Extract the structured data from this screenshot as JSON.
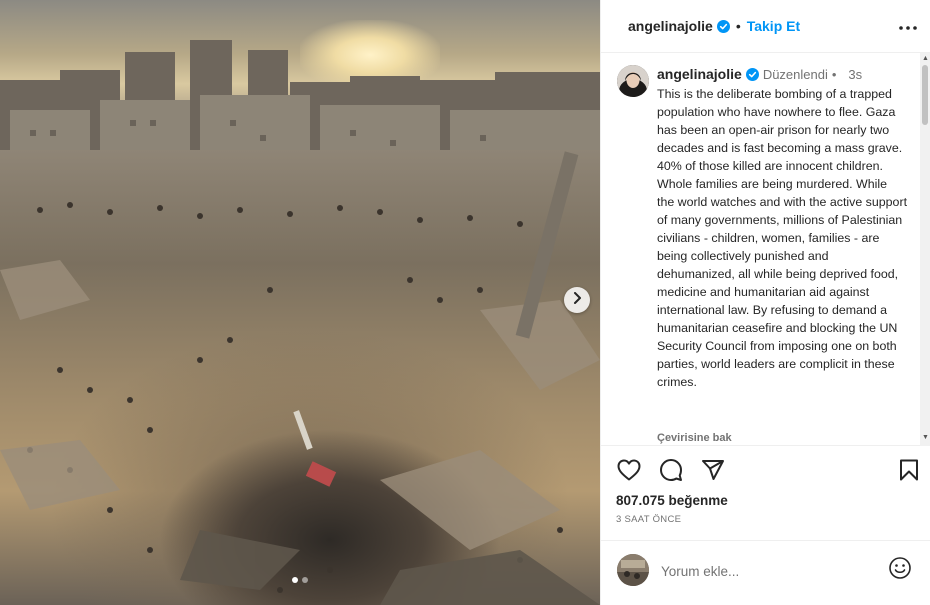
{
  "post": {
    "username": "angelinajolie",
    "follow_label": "Takip Et",
    "separator": "•",
    "edited_label": "Düzenlendi",
    "caption_time": "3s",
    "caption": "This is the deliberate bombing of a trapped population who have nowhere to flee. Gaza has been an open-air prison for nearly two decades and is fast becoming a mass grave. 40% of those killed are innocent children. Whole families are being murdered. While the world watches and with the active support of many governments, millions of Palestinian civilians - children, women, families - are being collectively punished and dehumanized, all while being deprived food, medicine and humanitarian aid against international law. By refusing to demand a humanitarian ceasefire and blocking the UN Security Council from imposing one on both parties, world leaders are complicit in these crimes.",
    "translate_label": "Çevirisine bak",
    "likes": "807.075 beğenme",
    "posted_ago": "3 SAAT ÖNCE",
    "comment_placeholder": "Yorum ekle...",
    "carousel": {
      "slide_count": 2,
      "active_index": 0
    }
  },
  "icons": {
    "verified": "verified-badge-icon",
    "more": "more-options-icon",
    "like": "heart-icon",
    "comment": "comment-icon",
    "share": "send-icon",
    "save": "bookmark-icon",
    "next": "chevron-right-icon",
    "emoji": "smiley-icon"
  },
  "colors": {
    "accent": "#0095f6",
    "text": "#262626",
    "secondary": "#737373",
    "divider": "#efefef"
  }
}
